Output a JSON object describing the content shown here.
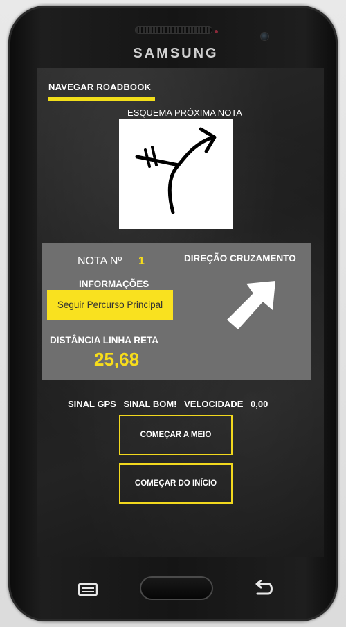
{
  "device": {
    "brand": "SAMSUNG"
  },
  "screen": {
    "title": "NAVEGAR ROADBOOK",
    "next_note_label": "ESQUEMA PRÓXIMA NOTA",
    "note_number_label": "NOTA Nº",
    "note_number_value": "1",
    "crossing_direction_label": "DIREÇÃO CRUZAMENTO",
    "info_label": "INFORMAÇÕES",
    "info_value": "Seguir Percurso Principal",
    "distance_label": "DISTÂNCIA LINHA RETA",
    "distance_value": "25,68",
    "gps_label": "SINAL GPS",
    "gps_value": "SINAL BOM!",
    "speed_label": "VELOCIDADE",
    "speed_value": "0,00",
    "start_middle_button": "COMEÇAR A MEIO",
    "start_beginning_button": "COMEÇAR DO INÍCIO"
  },
  "colors": {
    "accent": "#f2de1a",
    "panel": "#6f6f6f",
    "info_box": "#f9e11f"
  },
  "icons": [
    "roadbook-diagram-icon",
    "direction-arrow-icon",
    "menu-icon",
    "home-button",
    "back-icon"
  ]
}
